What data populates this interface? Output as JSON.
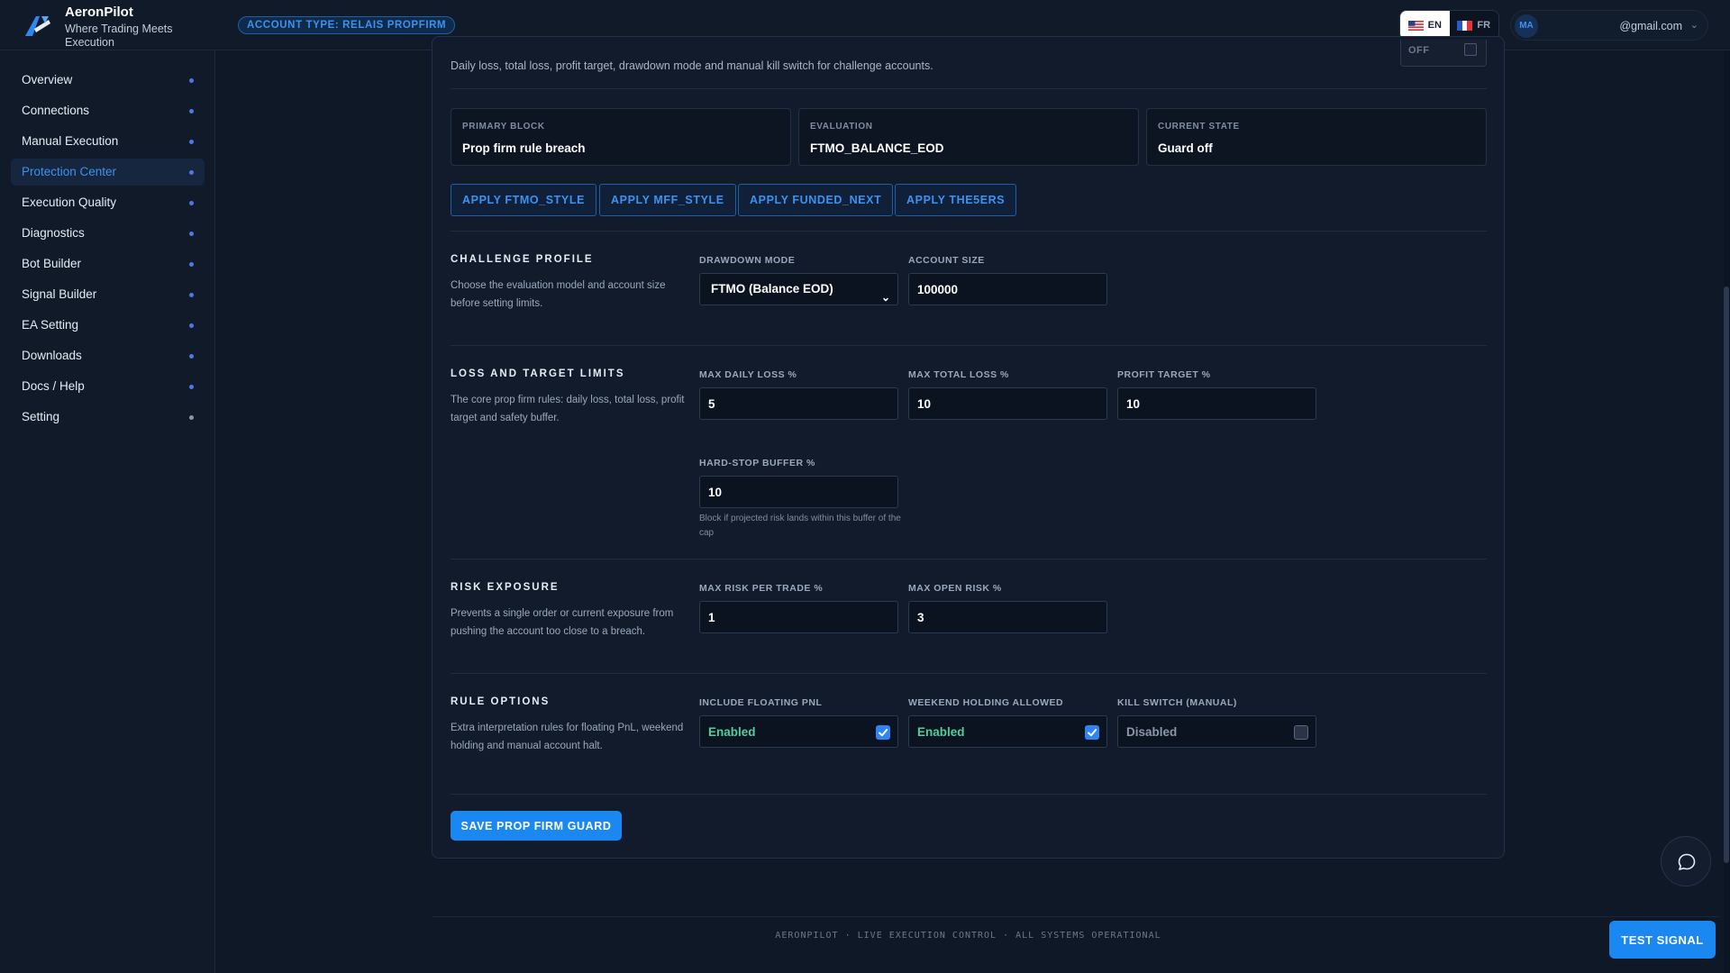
{
  "brand": {
    "name": "AeronPilot",
    "tagline": "Where Trading Meets Execution"
  },
  "header": {
    "account_badge": "ACCOUNT TYPE: RELAIS PROPFIRM",
    "languages": [
      {
        "code": "EN",
        "active": true
      },
      {
        "code": "FR",
        "active": false
      }
    ],
    "user": {
      "initials": "MA",
      "email": "@gmail.com"
    }
  },
  "sidebar": {
    "items": [
      {
        "label": "Overview"
      },
      {
        "label": "Connections"
      },
      {
        "label": "Manual Execution"
      },
      {
        "label": "Protection Center",
        "active": true
      },
      {
        "label": "Execution Quality"
      },
      {
        "label": "Diagnostics"
      },
      {
        "label": "Bot Builder"
      },
      {
        "label": "Signal Builder"
      },
      {
        "label": "EA Setting"
      },
      {
        "label": "Downloads"
      },
      {
        "label": "Docs / Help"
      },
      {
        "label": "Setting"
      }
    ]
  },
  "guard": {
    "toggle_label": "OFF",
    "description": "Daily loss, total loss, profit target, drawdown mode and manual kill switch for challenge accounts."
  },
  "stats": [
    {
      "label": "PRIMARY BLOCK",
      "value": "Prop firm rule breach"
    },
    {
      "label": "EVALUATION",
      "value": "FTMO_BALANCE_EOD"
    },
    {
      "label": "CURRENT STATE",
      "value": "Guard off"
    }
  ],
  "presets": [
    "APPLY FTMO_STYLE",
    "APPLY MFF_STYLE",
    "APPLY FUNDED_NEXT",
    "APPLY THE5ERS"
  ],
  "challenge_profile": {
    "title": "CHALLENGE PROFILE",
    "description": "Choose the evaluation model and account size before setting limits.",
    "drawdown_mode": {
      "label": "DRAWDOWN MODE",
      "value": "FTMO (Balance EOD)"
    },
    "account_size": {
      "label": "ACCOUNT SIZE",
      "value": "100000"
    }
  },
  "loss_limits": {
    "title": "LOSS AND TARGET LIMITS",
    "description": "The core prop firm rules: daily loss, total loss, profit target and safety buffer.",
    "max_daily_loss": {
      "label": "MAX DAILY LOSS %",
      "value": "5"
    },
    "max_total_loss": {
      "label": "MAX TOTAL LOSS %",
      "value": "10"
    },
    "profit_target": {
      "label": "PROFIT TARGET %",
      "value": "10"
    },
    "hard_stop_buffer": {
      "label": "HARD-STOP BUFFER %",
      "value": "10",
      "help": "Block if projected risk lands within this buffer of the cap"
    }
  },
  "risk_exposure": {
    "title": "RISK EXPOSURE",
    "description": "Prevents a single order or current exposure from pushing the account too close to a breach.",
    "max_risk_per_trade": {
      "label": "MAX RISK PER TRADE %",
      "value": "1"
    },
    "max_open_risk": {
      "label": "MAX OPEN RISK %",
      "value": "3"
    }
  },
  "rule_options": {
    "title": "RULE OPTIONS",
    "description": "Extra interpretation rules for floating PnL, weekend holding and manual account halt.",
    "include_floating_pnl": {
      "label": "INCLUDE FLOATING PNL",
      "state": "Enabled",
      "checked": true
    },
    "weekend_holding": {
      "label": "WEEKEND HOLDING ALLOWED",
      "state": "Enabled",
      "checked": true
    },
    "kill_switch": {
      "label": "KILL SWITCH (MANUAL)",
      "state": "Disabled",
      "checked": false
    }
  },
  "actions": {
    "save": "SAVE PROP FIRM GUARD",
    "test_signal": "TEST SIGNAL"
  },
  "footer": {
    "text": "AERONPILOT · LIVE EXECUTION CONTROL · ALL SYSTEMS OPERATIONAL"
  },
  "colors": {
    "accent": "#1a88f0",
    "success": "#4ed09a",
    "background": "#0f1826",
    "panel": "#111b2b"
  }
}
